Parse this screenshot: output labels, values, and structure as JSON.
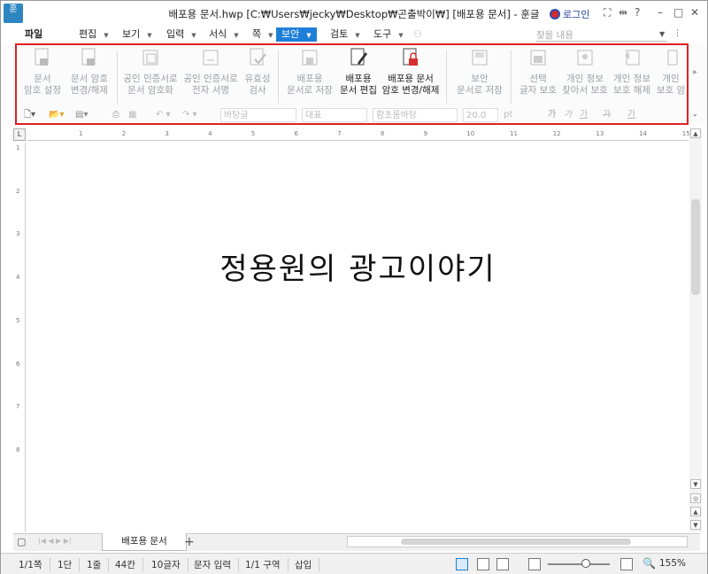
{
  "window": {
    "title": "배포용 문서.hwp [C:₩Users₩jecky₩Desktop₩곤출박이₩] [배포용 문서] - 훈글",
    "app_icon": "훈"
  },
  "titlebar": {
    "login": "로그인"
  },
  "menu": {
    "file": "파일",
    "items": [
      "편집",
      "보기",
      "입력",
      "서식",
      "쪽",
      "보안",
      "검토",
      "도구"
    ],
    "active": "보안",
    "search_placeholder": "찾을 내용"
  },
  "ribbon": {
    "buttons": [
      {
        "line1": "문서",
        "line2": "암호 설정",
        "enabled": false
      },
      {
        "line1": "문서 암호",
        "line2": "변경/해제",
        "enabled": false
      },
      {
        "line1": "공인 인증서로",
        "line2": "문서 암호화",
        "enabled": false
      },
      {
        "line1": "공인 인증서로",
        "line2": "전자 서명",
        "enabled": false
      },
      {
        "line1": "유효성",
        "line2": "검사",
        "enabled": false
      },
      {
        "line1": "배포용",
        "line2": "문서로 저장",
        "enabled": false
      },
      {
        "line1": "배포용",
        "line2": "문서 편집",
        "enabled": true
      },
      {
        "line1": "배포용 문서",
        "line2": "암호 변경/해제",
        "enabled": true
      },
      {
        "line1": "보안",
        "line2": "문서로 저장",
        "enabled": false
      },
      {
        "line1": "선택",
        "line2": "글자 보호",
        "enabled": false
      },
      {
        "line1": "개인 정보",
        "line2": "찾아서 보호",
        "enabled": false
      },
      {
        "line1": "개인 정보",
        "line2": "보호 해제",
        "enabled": false
      },
      {
        "line1": "개인",
        "line2": "보호 암",
        "enabled": false
      }
    ],
    "format": {
      "style": "바탕글",
      "outline": "대표",
      "font": "함초롬바탕",
      "size": "20.0",
      "unit": "pt",
      "glyphs": [
        "가",
        "가",
        "가",
        "가",
        "가"
      ]
    }
  },
  "ruler": {
    "ticks": [
      "1",
      "2",
      "3",
      "4",
      "5",
      "6",
      "7",
      "8",
      "9",
      "10",
      "11",
      "12",
      "13",
      "14",
      "15"
    ],
    "vticks": [
      "1",
      "2",
      "3",
      "4",
      "5",
      "6",
      "7",
      "8"
    ]
  },
  "document": {
    "text": "정용원의 광고이야기"
  },
  "tabs": {
    "active": "배포용 문서",
    "add": "+"
  },
  "status": {
    "page": "1/1쪽",
    "column": "1단",
    "line": "1줄",
    "col": "44칸",
    "chars": "10글자",
    "mode": "문자 입력",
    "section": "1/1 구역",
    "insert": "삽입",
    "zoom": "155%"
  },
  "colors": {
    "accent": "#1e7fd8",
    "highlight": "#e02020"
  }
}
